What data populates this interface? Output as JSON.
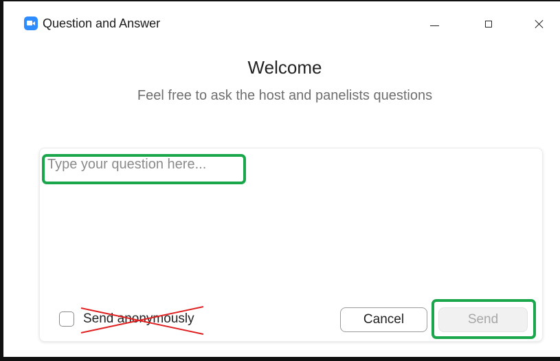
{
  "window": {
    "title": "Question and Answer",
    "icon": "zoom-camera-icon",
    "controls": {
      "minimize": "minimize-icon",
      "maximize": "maximize-icon",
      "close": "close-icon"
    }
  },
  "header": {
    "welcome": "Welcome",
    "subtitle": "Feel free to ask the host and panelists questions"
  },
  "question": {
    "value": "",
    "placeholder": "Type your question here..."
  },
  "footer": {
    "anonymous_label": "Send anonymously",
    "anonymous_checked": false,
    "cancel_label": "Cancel",
    "send_label": "Send",
    "send_enabled": false
  },
  "annotations": {
    "highlight_color": "#1aa64a",
    "strike_color": "#e02020"
  },
  "colors": {
    "brand": "#2d8cff",
    "text": "#222222",
    "muted": "#6e6e6e"
  }
}
